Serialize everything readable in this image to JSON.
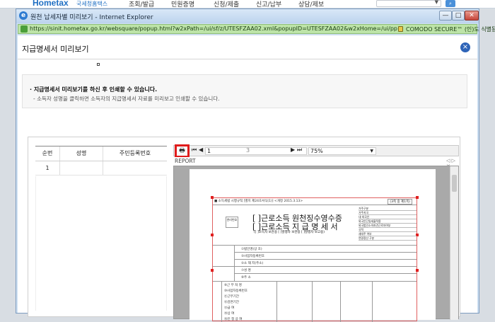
{
  "site": {
    "logo": "Hometax",
    "logo_sub": "국세청홈택스",
    "nav": [
      "조회/발급",
      "민원증명",
      "신청/제출",
      "신고/납부",
      "상담/제보"
    ],
    "search_btn_icon": "search-icon"
  },
  "window": {
    "title": "원천 납세자별 미리보기 - Internet Explorer",
    "controls": [
      "—",
      "□",
      "✕"
    ],
    "url": "https://sinit.hometax.go.kr/websquare/popup.html?w2xPath=/ui/sf/z/UTESFZAA02.xml&popupID=UTESFZAA02&w2xHome=/ui/pp/b/a/&w2xDocumentRoot=",
    "cert": "COMODO SECURE™ (인)도 식별됨"
  },
  "page": {
    "title": "지급명세서 미리보기",
    "close_label": "×",
    "info_line1": "· 지급명세서 미리보기를 하신 후 인쇄할 수 있습니다.",
    "info_line2": "- 소득자 성명을 클릭하면 소득자의 지급명세서 자료를 미리보고 인쇄할 수 있습니다."
  },
  "table": {
    "headers": [
      "순번",
      "성명",
      "주민등록번호"
    ],
    "rows": [
      {
        "no": "1",
        "name": "",
        "id": ""
      }
    ]
  },
  "viewer": {
    "print_icon": "printer-icon",
    "nav": {
      "first": "⏮",
      "prev": "◀",
      "next": "▶",
      "last": "⏭"
    },
    "current_page": "1",
    "total_pages": "3",
    "zoom": "75%",
    "tab_label": "REPORT",
    "tab_controls": "◁ ▷ ✕"
  },
  "form": {
    "header_text": "■ 소득세법 시행규칙 [별지 제24호서식(1)] <개정 2015.3.13>",
    "header_right": "(3쪽 중 제1쪽)",
    "title1": "[ ]근로소득 원천징수영수증",
    "title2": "[ ]근로소득 지 급 명 세 서",
    "title3": "([ ]소득자 보관용  [ ]발행자 보관용  [ ]발행자 보고용)",
    "stamp": "관리번호",
    "right_box": [
      "거주구분",
      "거주지국",
      "내·외국인",
      "외국인단일세율적용",
      "외국법인소속파견근로자여부",
      "국적",
      "세대주 여부",
      "연말정산 구분"
    ],
    "rows": [
      "①법인명(상 호)",
      "③사업자등록번호",
      "⑤소 재 지(주소)",
      "⑦성 명",
      "⑨주 소"
    ],
    "income_rows": [
      "⑨근 무 처 명",
      "⑩사업자등록번호",
      "⑪근무기간",
      "⑫감면기간",
      "⑬급 여",
      "⑭상 여",
      "⑮인 정 상 여"
    ]
  }
}
